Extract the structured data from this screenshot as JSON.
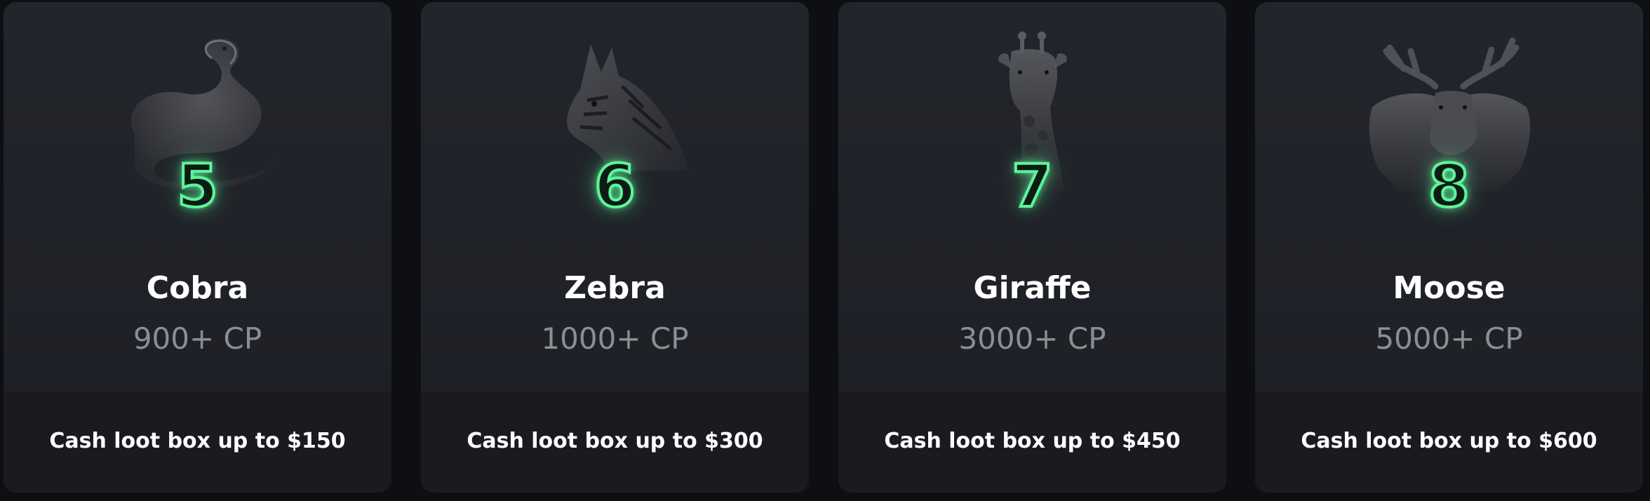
{
  "cards": [
    {
      "icon": "cobra-icon",
      "level": "5",
      "name": "Cobra",
      "cp": "900+ CP",
      "reward": "Cash loot box up to $150"
    },
    {
      "icon": "zebra-icon",
      "level": "6",
      "name": "Zebra",
      "cp": "1000+ CP",
      "reward": "Cash loot box up to $300"
    },
    {
      "icon": "giraffe-icon",
      "level": "7",
      "name": "Giraffe",
      "cp": "3000+ CP",
      "reward": "Cash loot box up to $450"
    },
    {
      "icon": "moose-icon",
      "level": "8",
      "name": "Moose",
      "cp": "5000+ CP",
      "reward": "Cash loot box up to $600"
    }
  ],
  "colors": {
    "background": "#0e0f13",
    "card": "#202228",
    "card_bottom": "#1a1b20",
    "neon_green": "#5cf59a",
    "title": "#ffffff",
    "subtitle": "#8c8e95"
  }
}
